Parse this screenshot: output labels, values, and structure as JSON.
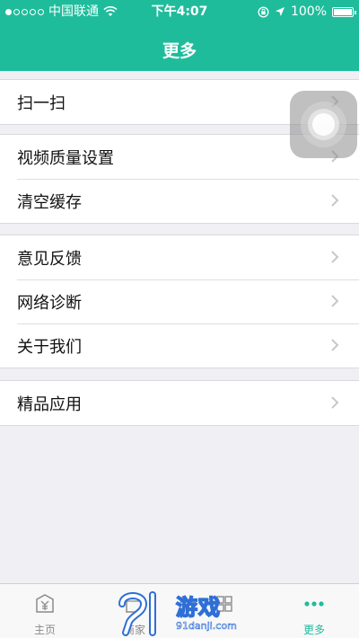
{
  "status_bar": {
    "carrier": "中国联通",
    "time": "下午4:07",
    "battery": "100%"
  },
  "header": {
    "title": "更多"
  },
  "groups": [
    {
      "items": [
        {
          "label": "扫一扫"
        }
      ]
    },
    {
      "items": [
        {
          "label": "视频质量设置"
        },
        {
          "label": "清空缓存"
        }
      ]
    },
    {
      "items": [
        {
          "label": "意见反馈"
        },
        {
          "label": "网络诊断"
        },
        {
          "label": "关于我们"
        }
      ]
    },
    {
      "items": [
        {
          "label": "精品应用"
        }
      ]
    }
  ],
  "tabbar": {
    "tabs": [
      {
        "label": "主页",
        "icon": "yuan-icon"
      },
      {
        "label": "商家",
        "icon": "shop-icon"
      },
      {
        "label": "",
        "icon": "app-icon"
      },
      {
        "label": "更多",
        "icon": "more-icon",
        "active": true
      }
    ]
  },
  "watermark": {
    "text": "游戏",
    "sub": "91danji.com"
  },
  "colors": {
    "accent": "#1fbc9c",
    "background": "#efeff4"
  }
}
